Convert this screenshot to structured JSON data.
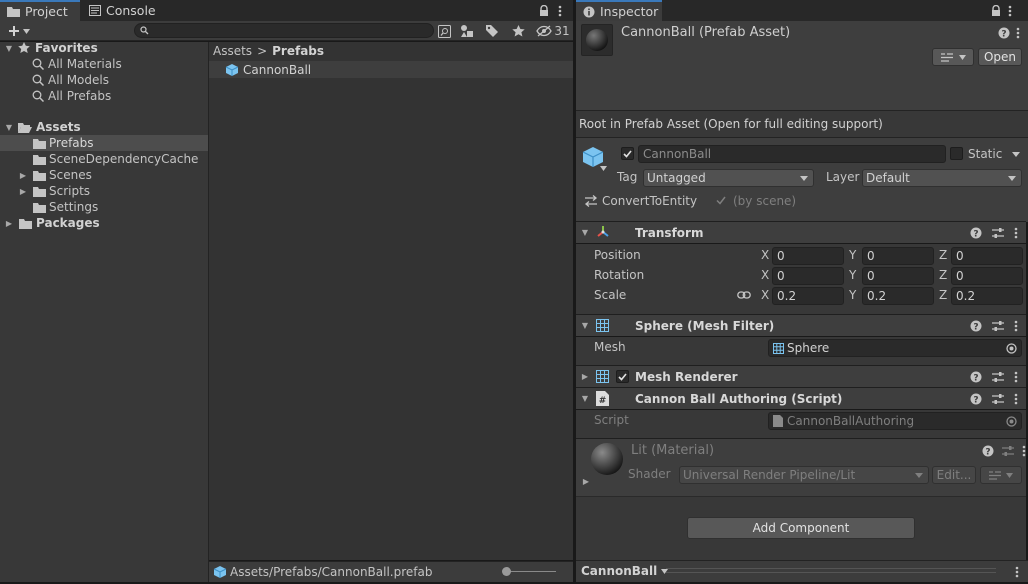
{
  "project_panel": {
    "tabs": [
      {
        "label": "Project",
        "icon": "folder-icon"
      },
      {
        "label": "Console",
        "icon": "console-icon"
      }
    ],
    "hidden_count": "31",
    "tree": {
      "favorites": {
        "label": "Favorites",
        "items": [
          "All Materials",
          "All Models",
          "All Prefabs"
        ]
      },
      "assets": {
        "label": "Assets",
        "items": [
          "Prefabs",
          "SceneDependencyCache",
          "Scenes",
          "Scripts",
          "Settings"
        ]
      },
      "packages": "Packages"
    },
    "breadcrumb": {
      "root": "Assets",
      "separator": ">",
      "current": "Prefabs"
    },
    "files": [
      {
        "name": "CannonBall",
        "icon": "prefab-cube-icon"
      }
    ],
    "status_path": "Assets/Prefabs/CannonBall.prefab"
  },
  "inspector": {
    "tab_label": "Inspector",
    "header": {
      "title": "CannonBall (Prefab Asset)",
      "open_button": "Open"
    },
    "root_notice": "Root in Prefab Asset (Open for full editing support)",
    "gameobject": {
      "name": "CannonBall",
      "static_label": "Static",
      "tag_label": "Tag",
      "tag_value": "Untagged",
      "layer_label": "Layer",
      "layer_value": "Default",
      "convert_label": "ConvertToEntity",
      "by_scene": "(by scene)"
    },
    "transform": {
      "title": "Transform",
      "rows": [
        {
          "label": "Position",
          "x": "0",
          "y": "0",
          "z": "0"
        },
        {
          "label": "Rotation",
          "x": "0",
          "y": "0",
          "z": "0"
        },
        {
          "label": "Scale",
          "x": "0.2",
          "y": "0.2",
          "z": "0.2"
        }
      ],
      "axes": [
        "X",
        "Y",
        "Z"
      ]
    },
    "mesh_filter": {
      "title": "Sphere (Mesh Filter)",
      "mesh_label": "Mesh",
      "mesh_value": "Sphere"
    },
    "mesh_renderer": {
      "title": "Mesh Renderer"
    },
    "script_comp": {
      "title": "Cannon Ball Authoring (Script)",
      "script_label": "Script",
      "script_value": "CannonBallAuthoring"
    },
    "material": {
      "title": "Lit (Material)",
      "shader_label": "Shader",
      "shader_value": "Universal Render Pipeline/Lit",
      "edit_button": "Edit..."
    },
    "add_component": "Add Component",
    "footer_label": "CannonBall"
  },
  "colors": {
    "accent": "#3a79bb",
    "panel": "#383838",
    "header": "#3e3e3e",
    "field": "#2a2a2a",
    "prefab": "#7bc4f0"
  }
}
